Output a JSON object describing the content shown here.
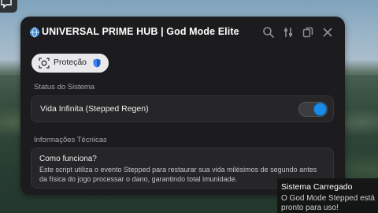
{
  "window": {
    "title": "UNIVERSAL PRIME HUB | God Mode Elite",
    "icons": [
      "globe-icon",
      "search-icon",
      "sliders-icon",
      "copy-icon",
      "close-icon"
    ]
  },
  "tabs": [
    {
      "label": "Proteção",
      "icon": "target-icon",
      "badge_icon": "shield-icon",
      "active": true
    }
  ],
  "status": {
    "section_label": "Status do Sistema",
    "toggle_label": "Vida Infinita (Stepped Regen)",
    "toggle_on": true
  },
  "info": {
    "section_label": "Informações Técnicas",
    "heading": "Como funciona?",
    "body": "Este script utiliza o evento Stepped para restaurar sua vida milésimos de segundo antes da física do jogo processar o dano, garantindo total imunidade."
  },
  "notification": {
    "title": "Sistema Carregado",
    "message": "O God Mode Stepped está pronto para uso!"
  },
  "colors": {
    "accent": "#1a8be6",
    "window_bg": "#1c1c1e",
    "card_bg": "#262628",
    "shield": "#3b82f6"
  }
}
